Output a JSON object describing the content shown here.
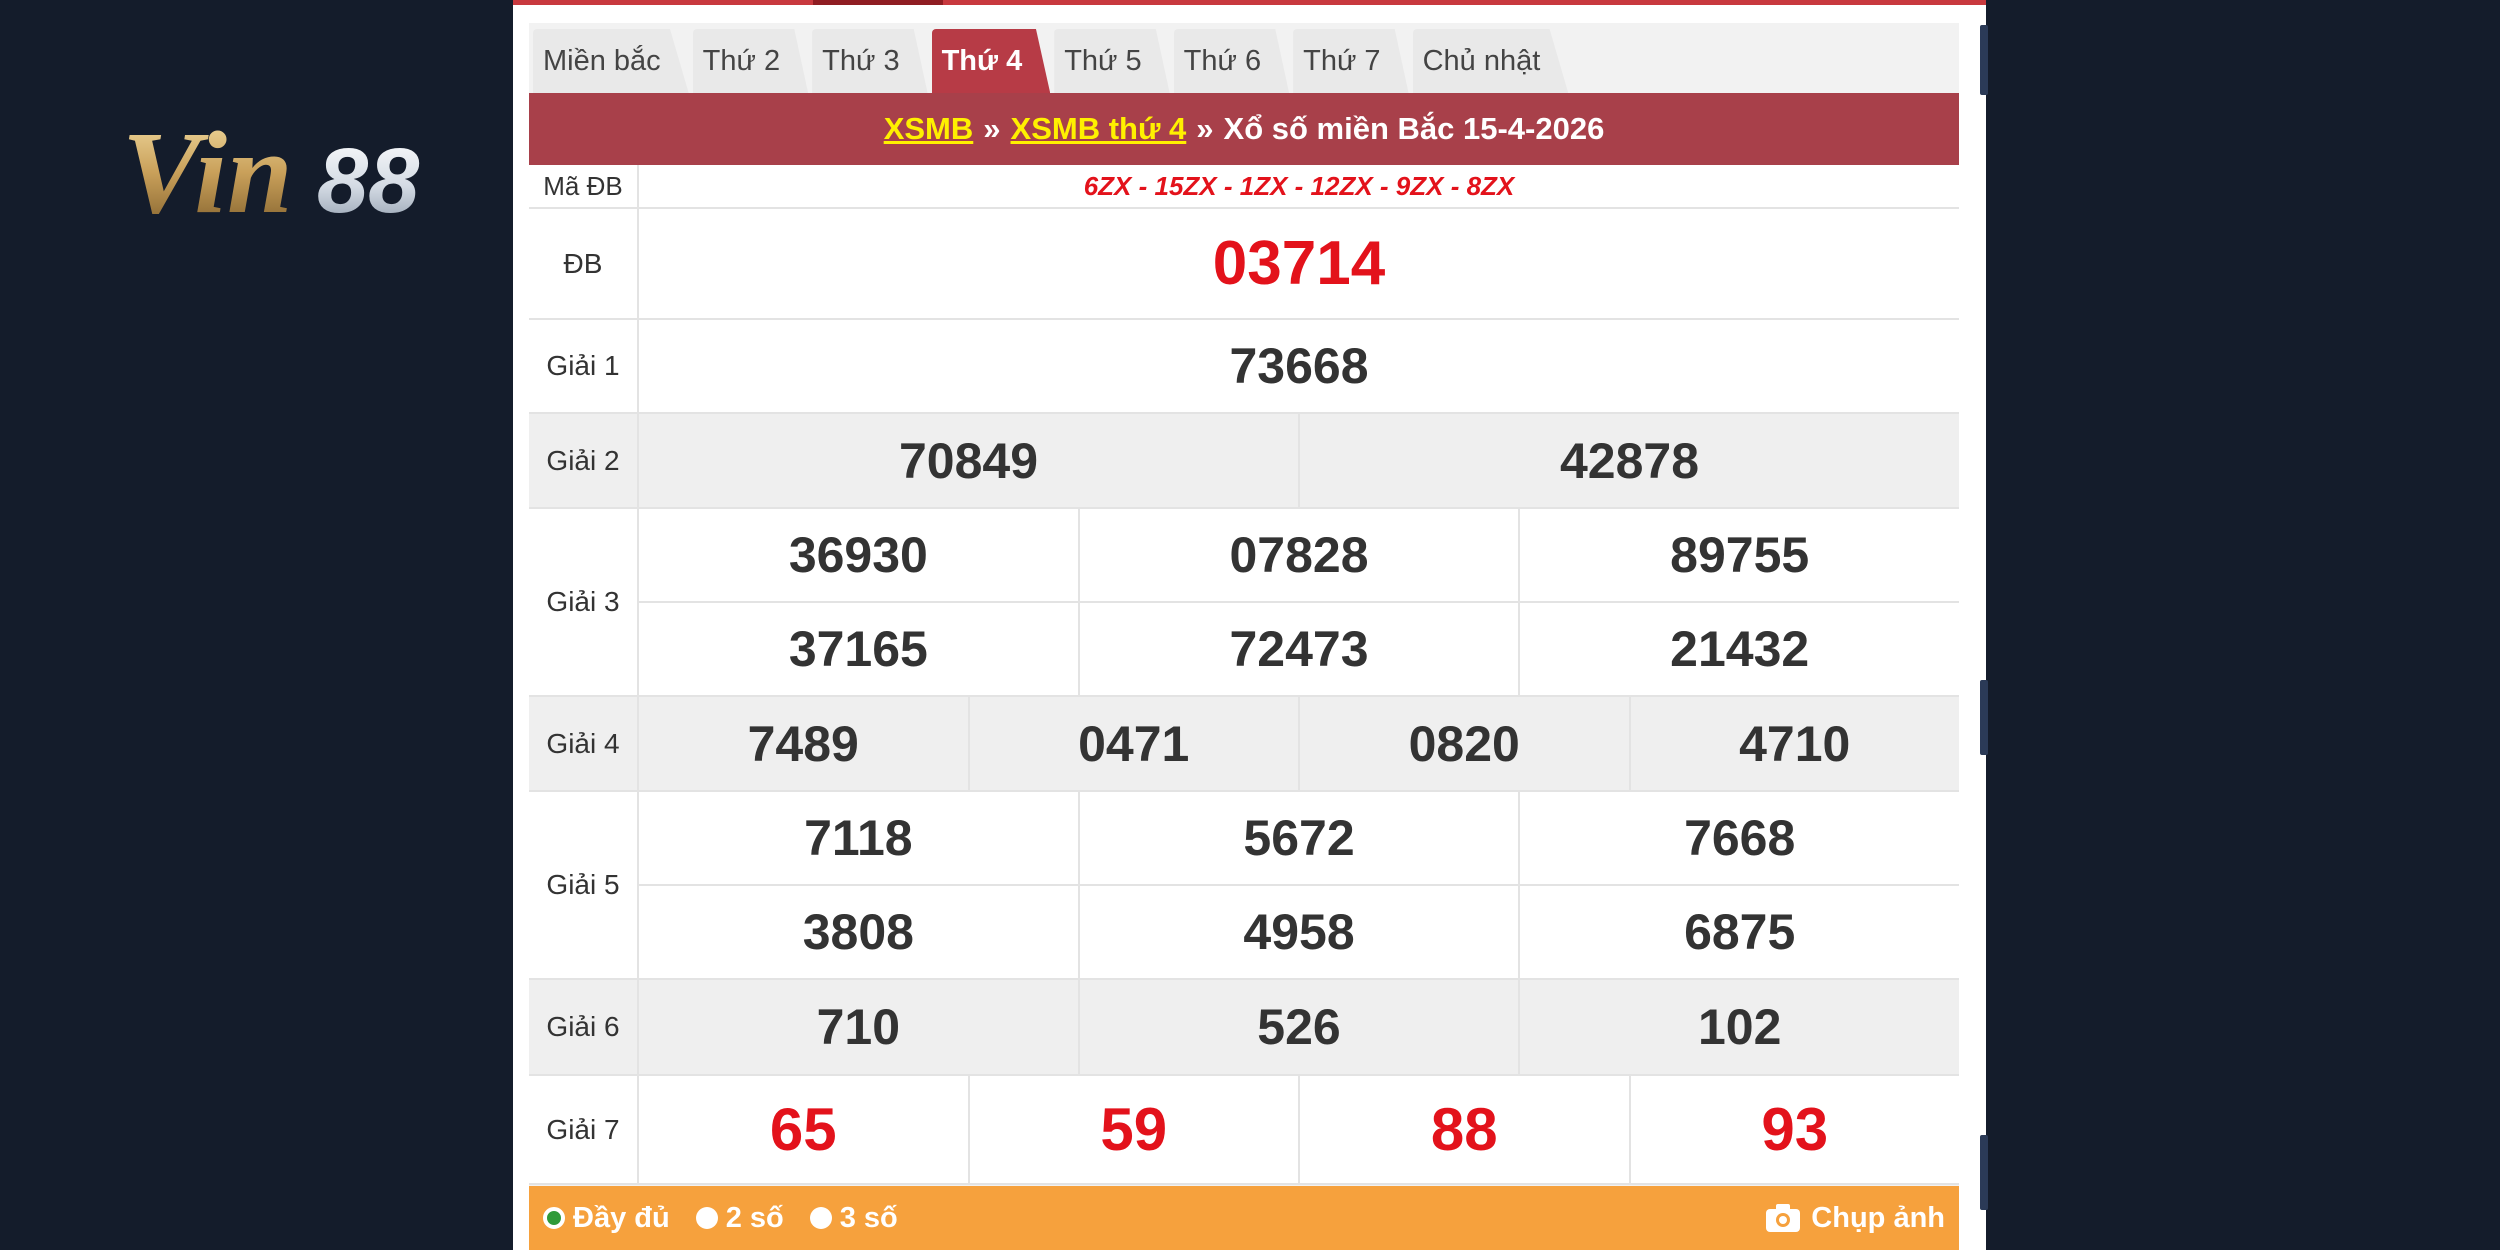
{
  "logo": {
    "text": "Vin88"
  },
  "tabs": [
    {
      "label": "Miền bắc",
      "active": false
    },
    {
      "label": "Thứ 2",
      "active": false
    },
    {
      "label": "Thứ 3",
      "active": false
    },
    {
      "label": "Thứ 4",
      "active": true
    },
    {
      "label": "Thứ 5",
      "active": false
    },
    {
      "label": "Thứ 6",
      "active": false
    },
    {
      "label": "Thứ 7",
      "active": false
    },
    {
      "label": "Chủ nhật",
      "active": false
    }
  ],
  "header": {
    "link1": "XSMB",
    "sep1": "»",
    "link2": "XSMB thứ 4",
    "sep2": "»",
    "title": "Xổ số miền Bắc 15-4-2026"
  },
  "results": {
    "madb": {
      "label": "Mã ĐB",
      "value": "6ZX - 15ZX - 1ZX - 12ZX - 9ZX - 8ZX"
    },
    "db": {
      "label": "ĐB",
      "numbers": [
        "03714"
      ]
    },
    "g1": {
      "label": "Giải 1",
      "numbers": [
        "73668"
      ]
    },
    "g2": {
      "label": "Giải 2",
      "numbers": [
        "70849",
        "42878"
      ]
    },
    "g3": {
      "label": "Giải 3",
      "numbers": [
        "36930",
        "07828",
        "89755",
        "37165",
        "72473",
        "21432"
      ]
    },
    "g4": {
      "label": "Giải 4",
      "numbers": [
        "7489",
        "0471",
        "0820",
        "4710"
      ]
    },
    "g5": {
      "label": "Giải 5",
      "numbers": [
        "7118",
        "5672",
        "7668",
        "3808",
        "4958",
        "6875"
      ]
    },
    "g6": {
      "label": "Giải 6",
      "numbers": [
        "710",
        "526",
        "102"
      ]
    },
    "g7": {
      "label": "Giải 7",
      "numbers": [
        "65",
        "59",
        "88",
        "93"
      ]
    }
  },
  "footer": {
    "options": [
      {
        "label": "Đầy đủ",
        "checked": true
      },
      {
        "label": "2 số",
        "checked": false
      },
      {
        "label": "3 số",
        "checked": false
      }
    ],
    "snapshot_label": "Chụp ảnh"
  },
  "colors": {
    "page_bg": "#141c2b",
    "header_bg": "#a8404a",
    "active_tab": "#b73b46",
    "footer_bg": "#f6a13d",
    "accent_red": "#e3121b",
    "link_yellow": "#fff000"
  }
}
